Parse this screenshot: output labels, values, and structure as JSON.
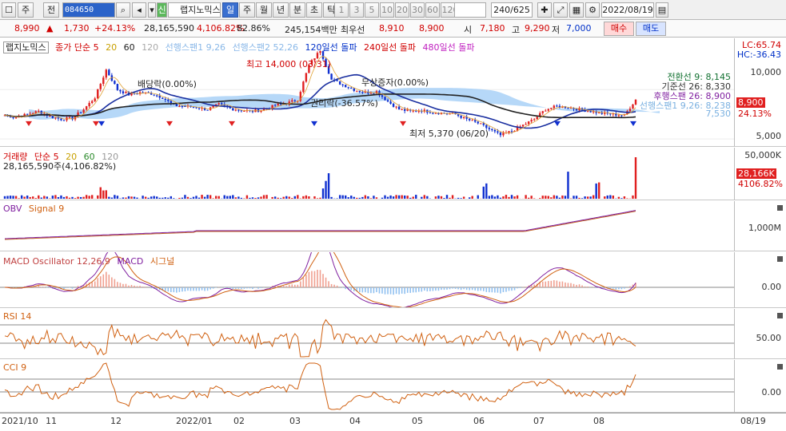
{
  "toolbar": {
    "menu_btn": "☐",
    "type_label": "주",
    "jeon_label": "전",
    "code": "084650",
    "stock_name": "랩지노믹스",
    "periods": [
      "일",
      "주",
      "월",
      "년",
      "분",
      "초",
      "틱"
    ],
    "intervals": [
      "1",
      "3",
      "5",
      "10",
      "20",
      "30",
      "60",
      "120"
    ],
    "count": "240/625",
    "date": "2022/08/19",
    "shin_label": "신"
  },
  "quote": {
    "price": "8,990",
    "change": "1,730",
    "change_pct": "+24.13%",
    "volume": "28,165,590",
    "volume_ratio": "4,106.82%",
    "turnover_pct": "82.86%",
    "amount": "245,154백만",
    "best_ask_label": "최우선",
    "best_ask": "8,910",
    "best_bid": "8,900",
    "open_label": "시",
    "open": "7,180",
    "high_label": "고",
    "high": "9,290",
    "low_label": "저",
    "low": "7,000",
    "buy": "매수",
    "sell": "매도"
  },
  "price_panel": {
    "legend": {
      "name": "랩지노믹스",
      "ma": "종가 단순 5",
      "ma20": "20",
      "ma60": "60",
      "ma120": "120",
      "ma240": "240",
      "span1": "선행스팬1 9,26",
      "span2": "선행스팬2 52,26",
      "sig120": "120일선 돌파",
      "sig240": "240일선 돌파",
      "sig480": "480일선 돌파"
    },
    "annotations": {
      "high": "최고 14,000 (03/31)",
      "low": "최저 5,370 (06/20)",
      "div": "배당락(0.00%)",
      "bonus": "무상증자(0.00%)",
      "right": "권리락(-36.57%)"
    },
    "ichimoku": {
      "conv": "전환선 9: 8,145",
      "base": "기준선 26: 8,330",
      "lag": "후행스팬 26: 8,900",
      "span1_val": "선행스팬1 9,26: 8,238",
      "span2_val": "7,530"
    },
    "lc": "LC:65.74",
    "hc": "HC:-36.43",
    "y_labels": [
      "10,000",
      "5,000"
    ],
    "cur_price": "8,900",
    "cur_pct": "24.13%"
  },
  "volume_panel": {
    "legend": {
      "name": "거래량",
      "ma": "단순 5",
      "ma20": "20",
      "ma60": "60",
      "ma120": "120"
    },
    "sub": "28,165,590주(4,106.82%)",
    "y_label": "50,000K",
    "cur": "28,166K",
    "cur_pct": "4106.82%"
  },
  "obv_panel": {
    "legend": {
      "name": "OBV",
      "signal": "Signal 9"
    },
    "y_label": "1,000M"
  },
  "macd_panel": {
    "legend": {
      "osc": "MACD Oscillator 12,26,9",
      "macd": "MACD",
      "signal": "시그널"
    },
    "y_label": "0.00"
  },
  "rsi_panel": {
    "legend": {
      "name": "RSI 14"
    },
    "y_label": "50.00"
  },
  "cci_panel": {
    "legend": {
      "name": "CCI 9"
    },
    "y_label": "0.00"
  },
  "x_axis": {
    "labels": [
      "2021/10",
      "11",
      "12",
      "2022/01",
      "02",
      "03",
      "04",
      "05",
      "06",
      "07",
      "08"
    ],
    "right": "08/19"
  },
  "colors": {
    "up": "#e02020",
    "down": "#1030d0",
    "ma5": "#f07020",
    "macd": "#8a2be2",
    "cloud": "#9ecbf5"
  },
  "chart_data": {
    "type": "line",
    "title": "랩지노믹스",
    "series": [
      {
        "name": "종가",
        "values": [
          7400,
          7200,
          7500,
          7800,
          7300,
          7000,
          7100,
          8000,
          9200,
          12000,
          10000,
          9500,
          9700,
          9600,
          9200,
          8400,
          8300,
          8200,
          8000,
          8500,
          8100,
          7900,
          7800,
          8000,
          8400,
          8600,
          9000,
          12500,
          14000,
          11000,
          10500,
          10000,
          9700,
          9800,
          8800,
          8000,
          7800,
          7900,
          7700,
          7600,
          7500,
          7000,
          6600,
          6000,
          5370,
          5800,
          6400,
          7000,
          8000,
          8300,
          8200,
          8000,
          7800,
          7600,
          7500,
          7400,
          8990
        ]
      }
    ]
  }
}
